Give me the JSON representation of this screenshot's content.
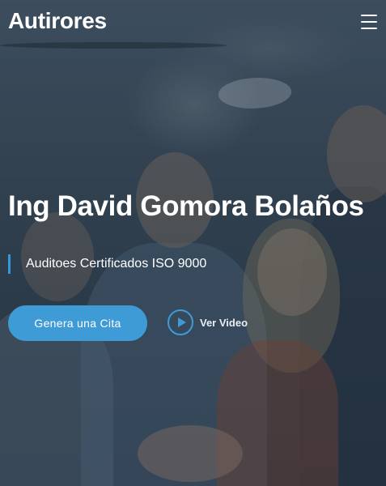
{
  "header": {
    "logo_text": "Autirores",
    "menu_icon": "hamburger-icon"
  },
  "hero": {
    "title": "Ing David Gomora Bolaños",
    "subtitle": "Auditoes Certificados ISO 9000",
    "cta_label": "Genera una Cita",
    "video_label": "Ver Video",
    "play_icon": "play-icon"
  },
  "colors": {
    "accent": "#3f9bd6",
    "text": "#ffffff"
  }
}
